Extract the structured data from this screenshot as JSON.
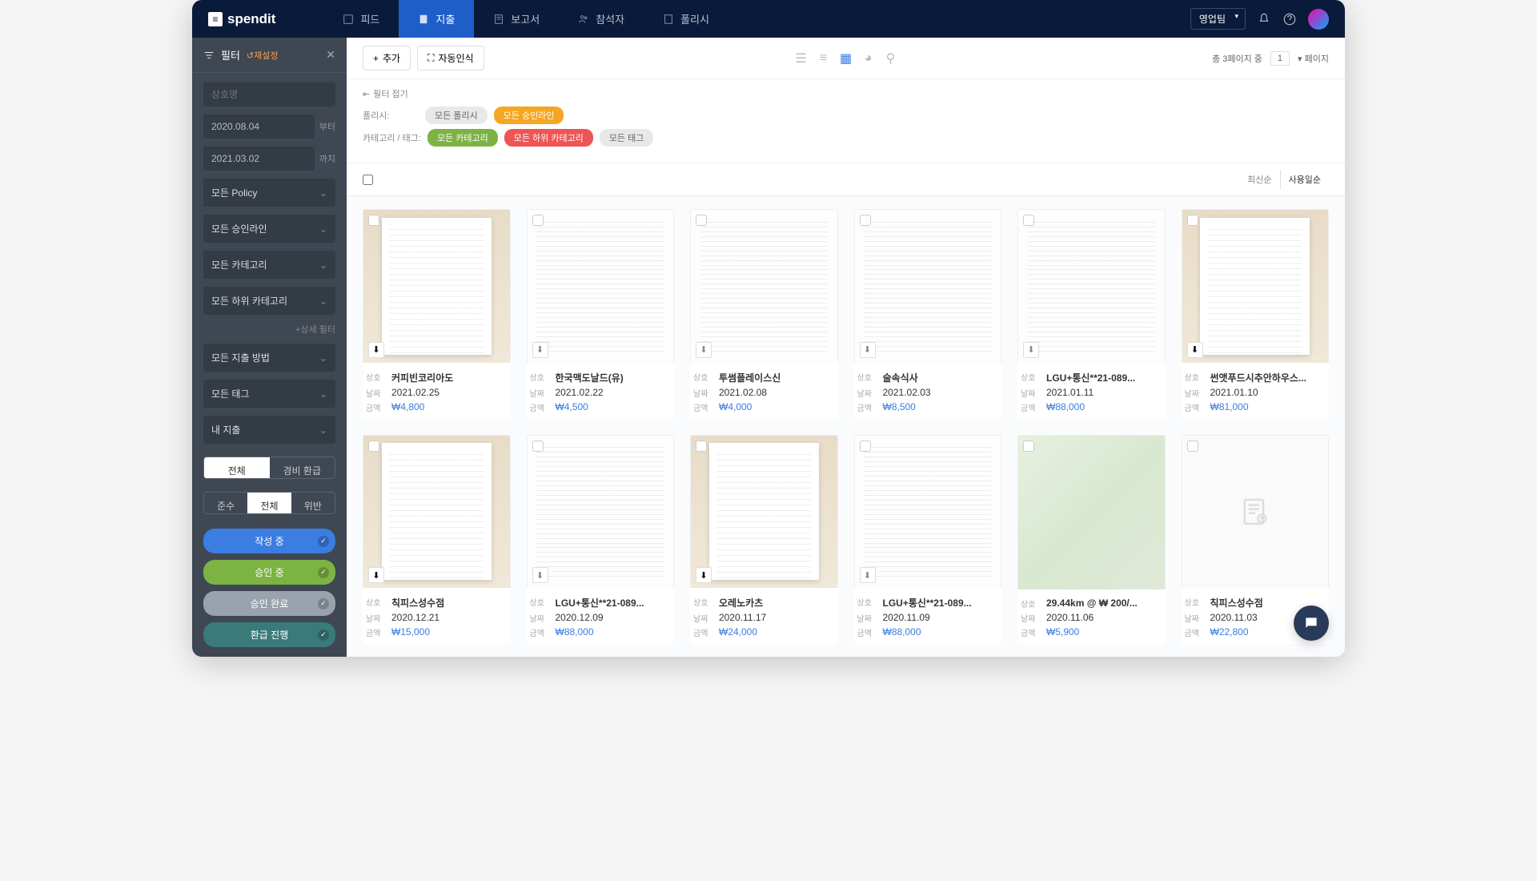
{
  "brand": "spendit",
  "nav": {
    "feed": "피드",
    "expense": "지출",
    "report": "보고서",
    "members": "참석자",
    "policy": "폴리시"
  },
  "team_select": "영업팀",
  "sidebar": {
    "title": "필터",
    "reset": "↺재설정",
    "merchant_placeholder": "상호명",
    "date_from": "2020.08.04",
    "date_from_label": "부터",
    "date_to": "2021.03.02",
    "date_to_label": "까지",
    "selects": {
      "policy": "모든 Policy",
      "approval": "모든 승인라인",
      "category": "모든 카테고리",
      "subcategory": "모든 하위 카테고리",
      "method": "모든 지출 방법",
      "tag": "모든 태그",
      "my": "내 지출"
    },
    "detail_filter": "+상세 필터",
    "toggle1": {
      "all": "전체",
      "reimburse": "경비 환급"
    },
    "toggle2": {
      "compliant": "준수",
      "all": "전체",
      "violation": "위반"
    },
    "status": {
      "writing": "작성 중",
      "approving": "승인 중",
      "approved": "승인 완료",
      "refund": "환급 진행"
    }
  },
  "toolbar": {
    "add": "추가",
    "auto": "자동인식",
    "page_info": "총 3페이지 중",
    "page_num": "1",
    "page_label": "페이지"
  },
  "filterbar": {
    "collapse": "필터 접기",
    "policy_label": "폴리시:",
    "all_policy": "모든 폴리시",
    "all_approval": "모든 승인라인",
    "category_label": "카테고리 / 태그:",
    "all_category": "모든 카테고리",
    "all_subcategory": "모든 하위 카테고리",
    "all_tag": "모든 태그"
  },
  "sort": {
    "newest": "최신순",
    "usage": "사용일순"
  },
  "labels": {
    "merchant": "상호",
    "date": "날짜",
    "amount": "금액"
  },
  "cards": [
    {
      "name": "커피빈코리아도",
      "date": "2021.02.25",
      "amount": "₩4,800",
      "type": "photo"
    },
    {
      "name": "한국맥도날드(유)",
      "date": "2021.02.22",
      "amount": "₩4,500",
      "type": "white"
    },
    {
      "name": "투썸플레이스신",
      "date": "2021.02.08",
      "amount": "₩4,000",
      "type": "white"
    },
    {
      "name": "술속식사",
      "date": "2021.02.03",
      "amount": "₩8,500",
      "type": "white"
    },
    {
      "name": "LGU+통신**21-089...",
      "date": "2021.01.11",
      "amount": "₩88,000",
      "type": "white"
    },
    {
      "name": "썬앳푸드시추안하우스...",
      "date": "2021.01.10",
      "amount": "₩81,000",
      "type": "photo"
    },
    {
      "name": "칙피스성수점",
      "date": "2020.12.21",
      "amount": "₩15,000",
      "type": "photo"
    },
    {
      "name": "LGU+통신**21-089...",
      "date": "2020.12.09",
      "amount": "₩88,000",
      "type": "white"
    },
    {
      "name": "오레노카츠",
      "date": "2020.11.17",
      "amount": "₩24,000",
      "type": "photo"
    },
    {
      "name": "LGU+통신**21-089...",
      "date": "2020.11.09",
      "amount": "₩88,000",
      "type": "white"
    },
    {
      "name": "29.44km @ ₩ 200/...",
      "date": "2020.11.06",
      "amount": "₩5,900",
      "type": "map"
    },
    {
      "name": "칙피스성수점",
      "date": "2020.11.03",
      "amount": "₩22,800",
      "type": "placeholder"
    }
  ]
}
